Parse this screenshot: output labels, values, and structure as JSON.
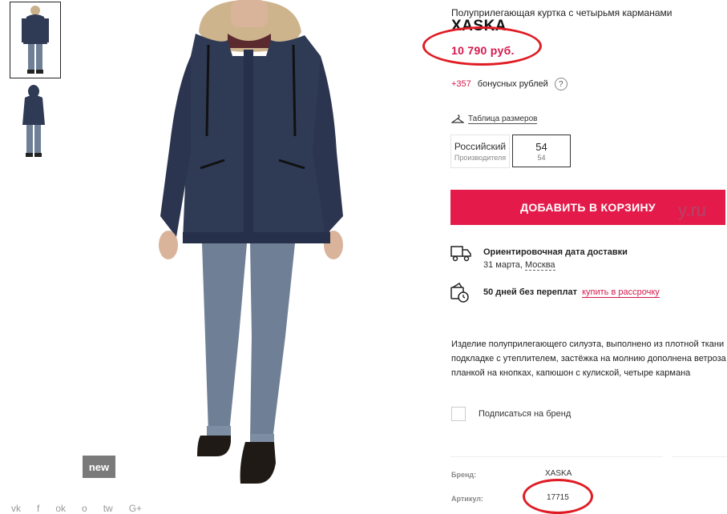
{
  "gallery": {
    "badge": "new",
    "social_icons": [
      "vk-icon",
      "facebook-icon",
      "odnoklassniki-icon",
      "share-icon",
      "twitter-icon",
      "google-plus-icon"
    ],
    "social_glyphs": [
      "vk",
      "f",
      "ok",
      "o",
      "tw",
      "G+"
    ]
  },
  "product": {
    "subtitle": "Полуприлегающая куртка с четырьмя карманами",
    "brand": "XASKA",
    "price": "10 790 руб.",
    "bonus_amount": "+357",
    "bonus_label": "бонусных рублей",
    "bonus_help": "?"
  },
  "sizes": {
    "table_link": "Таблица размеров",
    "system_label": "Российский",
    "system_sub": "Производителя",
    "selected_main": "54",
    "selected_sub": "54"
  },
  "cart": {
    "button_label": "ДОБАВИТЬ В КОРЗИНУ"
  },
  "watermark": "y.ru",
  "delivery": {
    "title": "Ориентировочная дата доставки",
    "date": "31 марта,",
    "city": "Москва"
  },
  "installment": {
    "text": "50 дней без переплат",
    "link": "купить в рассрочку"
  },
  "description": {
    "line1": "Изделие полуприлегающего силуэта, выполнено из плотной ткани",
    "line2": "подкладке с утеплителем, застёжка на молнию дополнена ветроза",
    "line3": "планкой на кнопках, капюшон с кулиской, четыре кармана"
  },
  "subscribe": {
    "label": "Подписаться на бренд"
  },
  "specs": {
    "brand_label": "Бренд:",
    "brand_value": "XASKA",
    "article_label": "Артикул:",
    "article_value": "17715"
  },
  "colors": {
    "accent": "#e41b4a",
    "price": "#d6184c",
    "annotation": "#e01b24",
    "jacket": "#2f3a55",
    "jeans": "#6f7f95"
  }
}
